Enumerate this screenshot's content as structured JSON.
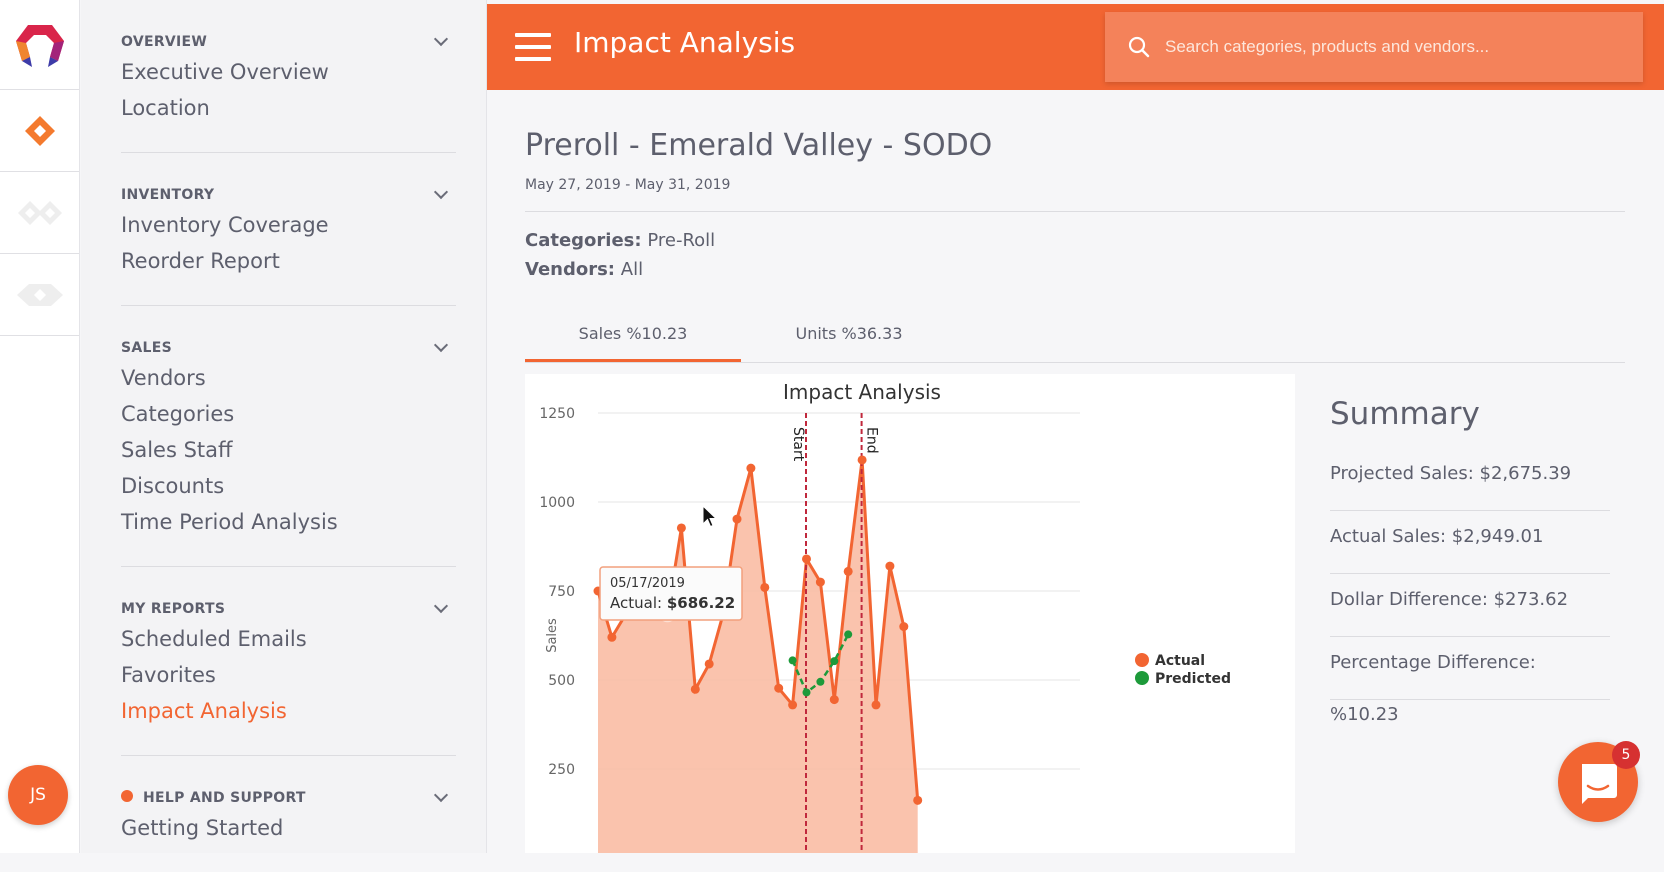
{
  "rail": {
    "items": [
      {
        "icon": "app-logo-icon"
      },
      {
        "icon": "diamond-icon",
        "active": true
      },
      {
        "icon": "double-diamond-icon"
      },
      {
        "icon": "eye-icon"
      }
    ],
    "avatar_initials": "JS"
  },
  "sidebar": {
    "sections": [
      {
        "label": "OVERVIEW",
        "items": [
          "Executive Overview",
          "Location"
        ]
      },
      {
        "label": "INVENTORY",
        "items": [
          "Inventory Coverage",
          "Reorder Report"
        ]
      },
      {
        "label": "SALES",
        "items": [
          "Vendors",
          "Categories",
          "Sales Staff",
          "Discounts",
          "Time Period Analysis"
        ]
      },
      {
        "label": "MY REPORTS",
        "items": [
          "Scheduled Emails",
          "Favorites",
          "Impact Analysis"
        ],
        "active_item": "Impact Analysis"
      },
      {
        "label": "HELP AND SUPPORT",
        "items": [
          "Getting Started"
        ]
      }
    ]
  },
  "header": {
    "title": "Impact Analysis",
    "search_placeholder": "Search categories, products and vendors..."
  },
  "report": {
    "title": "Preroll - Emerald Valley - SODO",
    "date_range": "May 27, 2019 - May 31, 2019",
    "categories_label": "Categories:",
    "categories_value": "Pre-Roll",
    "vendors_label": "Vendors:",
    "vendors_value": "All",
    "tabs": [
      {
        "label": "Sales %10.23",
        "active": true
      },
      {
        "label": "Units %36.33",
        "active": false
      }
    ]
  },
  "summary": {
    "title": "Summary",
    "rows": [
      "Projected Sales: $2,675.39",
      "Actual Sales: $2,949.01",
      "Dollar Difference: $273.62",
      "Percentage Difference: %10.23"
    ]
  },
  "chat": {
    "badge_count": "5"
  },
  "colors": {
    "brand": "#f26532",
    "actual": "#f26532",
    "actual_fill": "#f9b89f",
    "predicted": "#1d9a3a",
    "marker_line": "#c0283c"
  },
  "chart_data": {
    "type": "area",
    "title": "Impact Analysis",
    "xlabel": "",
    "ylabel": "Sales",
    "ylim": [
      0,
      1250
    ],
    "yticks": [
      250,
      500,
      750,
      1000,
      1250
    ],
    "grid": true,
    "legend_position": "right",
    "markers": [
      {
        "label": "Start",
        "index": 15
      },
      {
        "label": "End",
        "index": 19
      }
    ],
    "tooltip": {
      "date": "05/17/2019",
      "label": "Actual:",
      "value": "$686.22",
      "index": 5
    },
    "series": [
      {
        "name": "Actual",
        "values": [
          750,
          620,
          685,
          725,
          735,
          686.22,
          927,
          474,
          545,
          685,
          952,
          1095,
          760,
          477,
          430,
          840,
          775,
          445,
          805,
          1118,
          430,
          820,
          650,
          162
        ]
      },
      {
        "name": "Predicted",
        "start_index": 13,
        "values": [
          555,
          465,
          495,
          553,
          628
        ]
      }
    ]
  }
}
